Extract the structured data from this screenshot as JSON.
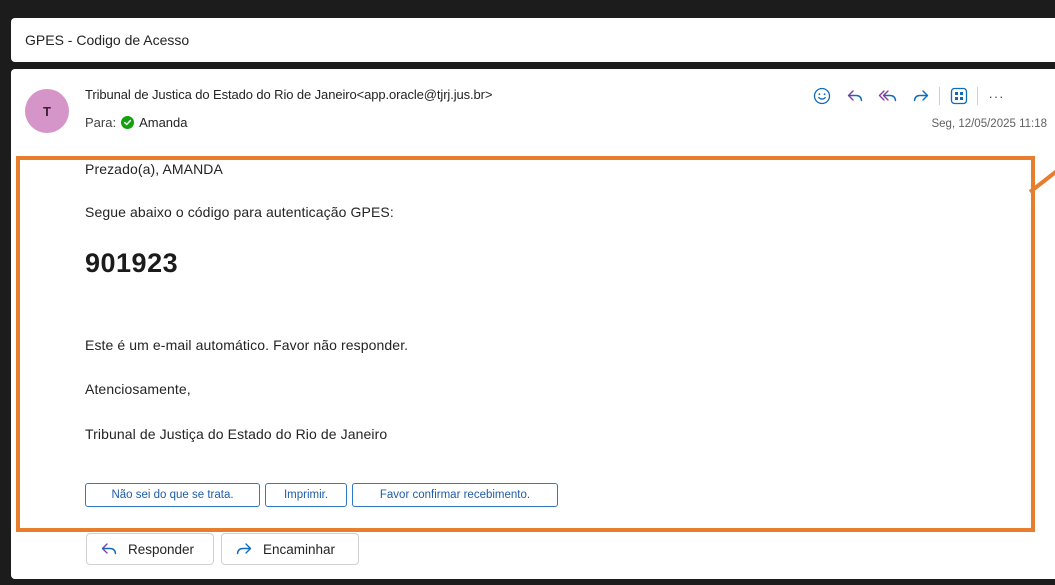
{
  "subject": "GPES - Codigo de Acesso",
  "email": {
    "avatar_initial": "T",
    "sender": "Tribunal de Justica do Estado do Rio de Janeiro<app.oracle@tjrj.jus.br>",
    "to_label": "Para:",
    "to_name": "Amanda",
    "date": "Seg, 12/05/2025 11:18",
    "actions": [
      "smiley-icon",
      "reply-icon",
      "reply-all-icon",
      "forward-icon",
      "apps-icon",
      "more-icon"
    ],
    "more_label": "···"
  },
  "body": {
    "greeting": "Prezado(a), AMANDA",
    "intro": "Segue abaixo o código para autenticação GPES:",
    "code": "901923",
    "notice": "Este é um e-mail automático. Favor não responder.",
    "closing": "Atenciosamente,",
    "signature": "Tribunal de Justiça do Estado do Rio de Janeiro"
  },
  "quick_replies": [
    "Não sei do que se trata.",
    "Imprimir.",
    "Favor confirmar recebimento."
  ],
  "reply_buttons": {
    "reply": "Responder",
    "forward": "Encaminhar"
  },
  "colors": {
    "background": "#1c1c1c",
    "avatar": "#d695c8",
    "accent": "#0f6cbd",
    "highlight": "#e67e2e",
    "check": "#13a10e"
  }
}
